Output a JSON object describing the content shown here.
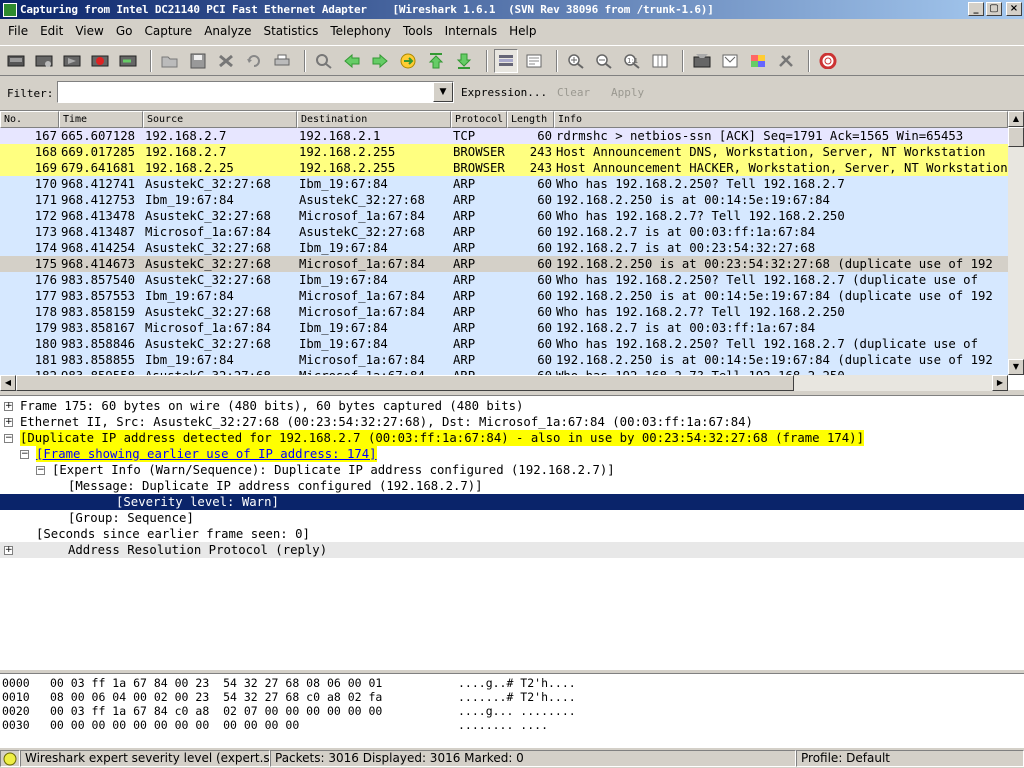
{
  "window": {
    "title": "Capturing from Intel DC21140 PCI Fast Ethernet Adapter    [Wireshark 1.6.1  (SVN Rev 38096 from /trunk-1.6)]",
    "minimize": "_",
    "maximize": "▢",
    "close": "×"
  },
  "menu": [
    "File",
    "Edit",
    "View",
    "Go",
    "Capture",
    "Analyze",
    "Statistics",
    "Telephony",
    "Tools",
    "Internals",
    "Help"
  ],
  "toolbar": {
    "icons": [
      "interface-list-icon",
      "capture-options-icon",
      "start-capture-icon",
      "stop-capture-icon",
      "restart-capture-icon",
      "open-file-icon",
      "save-file-icon",
      "close-file-icon",
      "reload-icon",
      "print-icon",
      "find-packet-icon",
      "go-back-icon",
      "go-forward-icon",
      "go-to-packet-icon",
      "go-first-icon",
      "go-last-icon",
      "colorize-icon",
      "autoscroll-icon",
      "zoom-in-icon",
      "zoom-out-icon",
      "normal-size-icon",
      "resize-columns-icon",
      "capture-filters-icon",
      "display-filters-icon",
      "coloring-rules-icon",
      "preferences-icon",
      "help-icon"
    ]
  },
  "filter": {
    "label": "Filter:",
    "value": "",
    "expression": "Expression...",
    "clear": "Clear",
    "apply": "Apply"
  },
  "packet_list": {
    "columns": [
      "No.",
      "Time",
      "Source",
      "Destination",
      "Protocol",
      "Length",
      "Info"
    ],
    "rows": [
      {
        "no": "167",
        "time": "665.607128",
        "src": "192.168.2.7",
        "dst": "192.168.2.1",
        "proto": "TCP",
        "len": "60",
        "info": "rdrmshc > netbios-ssn [ACK] Seq=1791 Ack=1565 Win=65453",
        "color": "#e7e6ff"
      },
      {
        "no": "168",
        "time": "669.017285",
        "src": "192.168.2.7",
        "dst": "192.168.2.255",
        "proto": "BROWSER",
        "len": "243",
        "info": "Host Announcement DNS, Workstation, Server, NT Workstation",
        "color": "#ffff80"
      },
      {
        "no": "169",
        "time": "679.641681",
        "src": "192.168.2.25",
        "dst": "192.168.2.255",
        "proto": "BROWSER",
        "len": "243",
        "info": "Host Announcement HACKER, Workstation, Server, NT Workstation",
        "color": "#ffff80"
      },
      {
        "no": "170",
        "time": "968.412741",
        "src": "AsustekC_32:27:68",
        "dst": "Ibm_19:67:84",
        "proto": "ARP",
        "len": "60",
        "info": "Who has 192.168.2.250?  Tell 192.168.2.7",
        "color": "#d6e8ff"
      },
      {
        "no": "171",
        "time": "968.412753",
        "src": "Ibm_19:67:84",
        "dst": "AsustekC_32:27:68",
        "proto": "ARP",
        "len": "60",
        "info": "192.168.2.250 is at 00:14:5e:19:67:84",
        "color": "#d6e8ff"
      },
      {
        "no": "172",
        "time": "968.413478",
        "src": "AsustekC_32:27:68",
        "dst": "Microsof_1a:67:84",
        "proto": "ARP",
        "len": "60",
        "info": "Who has 192.168.2.7?  Tell 192.168.2.250",
        "color": "#d6e8ff"
      },
      {
        "no": "173",
        "time": "968.413487",
        "src": "Microsof_1a:67:84",
        "dst": "AsustekC_32:27:68",
        "proto": "ARP",
        "len": "60",
        "info": "192.168.2.7 is at 00:03:ff:1a:67:84",
        "color": "#d6e8ff"
      },
      {
        "no": "174",
        "time": "968.414254",
        "src": "AsustekC_32:27:68",
        "dst": "Ibm_19:67:84",
        "proto": "ARP",
        "len": "60",
        "info": "192.168.2.7 is at 00:23:54:32:27:68",
        "color": "#d6e8ff"
      },
      {
        "no": "175",
        "time": "968.414673",
        "src": "AsustekC_32:27:68",
        "dst": "Microsof_1a:67:84",
        "proto": "ARP",
        "len": "60",
        "info": "192.168.2.250 is at 00:23:54:32:27:68 (duplicate use of 192",
        "color": "#d4d0c8"
      },
      {
        "no": "176",
        "time": "983.857540",
        "src": "AsustekC_32:27:68",
        "dst": "Ibm_19:67:84",
        "proto": "ARP",
        "len": "60",
        "info": "Who has 192.168.2.250?  Tell 192.168.2.7 (duplicate use of",
        "color": "#d6e8ff"
      },
      {
        "no": "177",
        "time": "983.857553",
        "src": "Ibm_19:67:84",
        "dst": "Microsof_1a:67:84",
        "proto": "ARP",
        "len": "60",
        "info": "192.168.2.250 is at 00:14:5e:19:67:84 (duplicate use of 192",
        "color": "#d6e8ff"
      },
      {
        "no": "178",
        "time": "983.858159",
        "src": "AsustekC_32:27:68",
        "dst": "Microsof_1a:67:84",
        "proto": "ARP",
        "len": "60",
        "info": "Who has 192.168.2.7?  Tell 192.168.2.250",
        "color": "#d6e8ff"
      },
      {
        "no": "179",
        "time": "983.858167",
        "src": "Microsof_1a:67:84",
        "dst": "Ibm_19:67:84",
        "proto": "ARP",
        "len": "60",
        "info": "192.168.2.7 is at 00:03:ff:1a:67:84",
        "color": "#d6e8ff"
      },
      {
        "no": "180",
        "time": "983.858846",
        "src": "AsustekC_32:27:68",
        "dst": "Ibm_19:67:84",
        "proto": "ARP",
        "len": "60",
        "info": "Who has 192.168.2.250?  Tell 192.168.2.7 (duplicate use of",
        "color": "#d6e8ff"
      },
      {
        "no": "181",
        "time": "983.858855",
        "src": "Ibm_19:67:84",
        "dst": "Microsof_1a:67:84",
        "proto": "ARP",
        "len": "60",
        "info": "192.168.2.250 is at 00:14:5e:19:67:84 (duplicate use of 192",
        "color": "#d6e8ff"
      },
      {
        "no": "182",
        "time": "983.859558",
        "src": "AsustekC_32:27:68",
        "dst": "Microsof_1a:67:84",
        "proto": "ARP",
        "len": "60",
        "info": "Who has 192.168.2.7?  Tell 192.168.2.250",
        "color": "#d6e8ff"
      }
    ]
  },
  "details": {
    "rows": [
      {
        "text": "Frame 175: 60 bytes on wire (480 bits), 60 bytes captured (480 bits)",
        "expander": "+",
        "bg": "#ffffff",
        "fg": "#000000"
      },
      {
        "text": "Ethernet II, Src: AsustekC_32:27:68 (00:23:54:32:27:68), Dst: Microsof_1a:67:84 (00:03:ff:1a:67:84)",
        "expander": "+",
        "bg": "#ffffff",
        "fg": "#000000"
      },
      {
        "text": "[Duplicate IP address detected for 192.168.2.7 (00:03:ff:1a:67:84) - also in use by 00:23:54:32:27:68 (frame 174)]",
        "expander": "−",
        "bg": "#ffff00",
        "fg": "#000000"
      },
      {
        "text": "[Frame showing earlier use of IP address: 174]",
        "expander": "−",
        "bg": "#ffff00",
        "fg": "#0000ff"
      },
      {
        "text": "[Expert Info (Warn/Sequence): Duplicate IP address configured (192.168.2.7)]",
        "expander": "−",
        "bg": "#ffffff",
        "fg": "#000000"
      },
      {
        "text": "[Message: Duplicate IP address configured (192.168.2.7)]",
        "expander": "",
        "bg": "#ffffff",
        "fg": "#000000"
      },
      {
        "text": "[Severity level: Warn]",
        "expander": "",
        "bg": "#0a246a",
        "fg": "#ffffff"
      },
      {
        "text": "[Group: Sequence]",
        "expander": "",
        "bg": "#ffffff",
        "fg": "#000000"
      },
      {
        "text": "[Seconds since earlier frame seen: 0]",
        "expander": "",
        "bg": "#ffffff",
        "fg": "#000000"
      },
      {
        "text": "Address Resolution Protocol (reply)",
        "expander": "+",
        "bg": "#e8e8e8",
        "fg": "#000000"
      }
    ]
  },
  "bytes": {
    "rows": [
      {
        "offset": "0000",
        "hex": "00 03 ff 1a 67 84 00 23  54 32 27 68 08 06 00 01",
        "ascii": "....g..# T2'h...."
      },
      {
        "offset": "0010",
        "hex": "08 00 06 04 00 02 00 23  54 32 27 68 c0 a8 02 fa",
        "ascii": ".......# T2'h...."
      },
      {
        "offset": "0020",
        "hex": "00 03 ff 1a 67 84 c0 a8  02 07 00 00 00 00 00 00",
        "ascii": "....g... ........"
      },
      {
        "offset": "0030",
        "hex": "00 00 00 00 00 00 00 00  00 00 00 00",
        "ascii": "........ ...."
      }
    ]
  },
  "status": {
    "field": "Wireshark expert severity level (expert.se...",
    "packets": "Packets: 3016 Displayed: 3016 Marked: 0",
    "profile": "Profile: Default"
  }
}
